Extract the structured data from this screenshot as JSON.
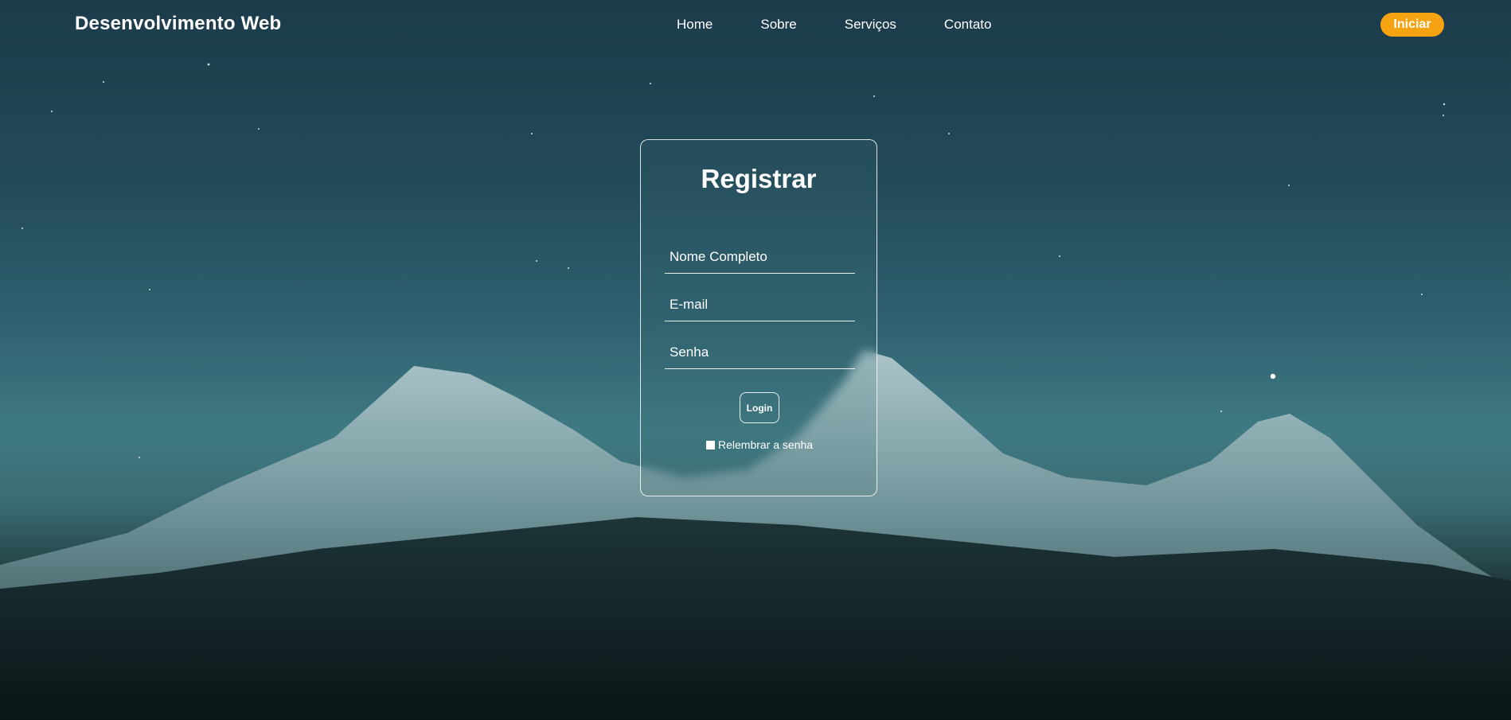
{
  "header": {
    "logo": "Desenvolvimento Web",
    "nav": [
      "Home",
      "Sobre",
      "Serviços",
      "Contato"
    ],
    "cta_label": "Iniciar",
    "cta_color": "#f5a310"
  },
  "form": {
    "title": "Registrar",
    "name_placeholder": "Nome Completo",
    "email_placeholder": "E-mail",
    "password_placeholder": "Senha",
    "login_label": "Login",
    "remember_label": "Relembrar a senha"
  }
}
